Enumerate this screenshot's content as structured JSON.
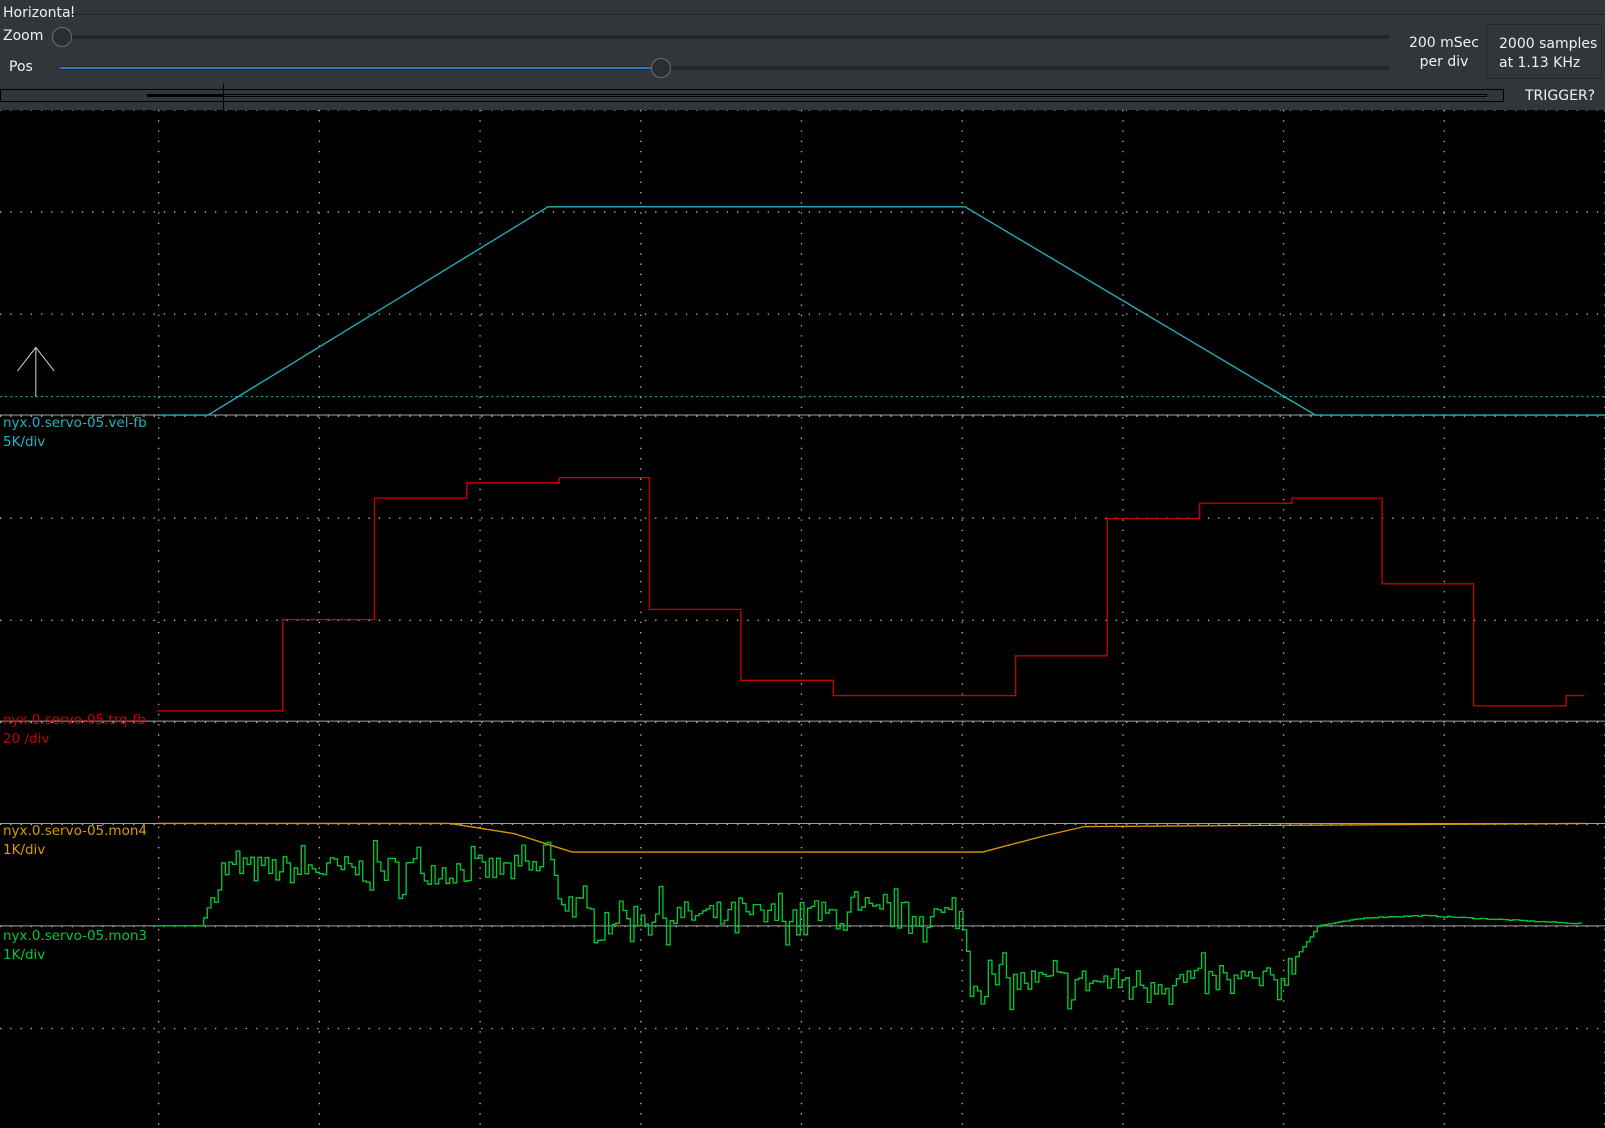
{
  "horizontal": {
    "group_label": "Horizontal",
    "zoom_label": "Zoom",
    "zoom_value": 0.0,
    "pos_label": "Pos",
    "pos_value": 0.45,
    "timebase_line1": "200 mSec",
    "timebase_line2": "per div",
    "samples_line1": "2000 samples",
    "samples_line2": "at 1.13 KHz",
    "trigger_label": "TRIGGER?"
  },
  "channels": [
    {
      "name": "nyx.0.servo-05.vel-fb",
      "scale": "5K/div",
      "color": "#1fb5c0"
    },
    {
      "name": "nyx.0.servo-05.trq-fb",
      "scale": "20 /div",
      "color": "#c80000"
    },
    {
      "name": "nyx.0.servo-05.mon4",
      "scale": "1K/div",
      "color": "#d99a00"
    },
    {
      "name": "nyx.0.servo-05.mon3",
      "scale": "1K/div",
      "color": "#00c832"
    }
  ],
  "chart_data": {
    "type": "line",
    "x_unit": "ms",
    "x_per_div": 200,
    "xlim": [
      0,
      2000
    ],
    "grid": true,
    "trigger_level": {
      "channel": 0,
      "value": 900
    },
    "series": [
      {
        "name": "nyx.0.servo-05.vel-fb",
        "units_per_div": 5000,
        "step": false,
        "points": [
          [
            195,
            0
          ],
          [
            259,
            0
          ],
          [
            682,
            10200
          ],
          [
            1201,
            10200
          ],
          [
            1637,
            0
          ],
          [
            1998,
            0
          ]
        ]
      },
      {
        "name": "nyx.0.servo-05.trq-fb",
        "units_per_div": 20,
        "step": true,
        "points": [
          [
            195,
            2.0
          ],
          [
            352,
            19.9
          ],
          [
            466,
            43.7
          ],
          [
            581,
            46.7
          ],
          [
            696,
            47.7
          ],
          [
            808,
            21.9
          ],
          [
            922,
            8.0
          ],
          [
            1037,
            5.0
          ],
          [
            1264,
            12.8
          ],
          [
            1378,
            39.7
          ],
          [
            1493,
            42.7
          ],
          [
            1608,
            43.7
          ],
          [
            1720,
            26.9
          ],
          [
            1834,
            3.0
          ],
          [
            1949,
            5.0
          ],
          [
            1972,
            5.0
          ]
        ]
      },
      {
        "name": "nyx.0.servo-05.mon4",
        "units_per_div": 1000,
        "step": false,
        "points": [
          [
            195,
            0
          ],
          [
            560,
            0
          ],
          [
            640,
            -100
          ],
          [
            712,
            -280
          ],
          [
            1223,
            -280
          ],
          [
            1300,
            -120
          ],
          [
            1350,
            -30
          ],
          [
            1974,
            0
          ]
        ]
      },
      {
        "name": "nyx.0.servo-05.mon3",
        "units_per_div": 1000,
        "step": true,
        "noise_amplitude": 180,
        "points": [
          [
            195,
            0
          ],
          [
            250,
            0
          ],
          [
            275,
            550
          ],
          [
            670,
            550
          ],
          [
            680,
            850
          ],
          [
            690,
            350
          ],
          [
            730,
            100
          ],
          [
            1195,
            100
          ],
          [
            1210,
            -550
          ],
          [
            1590,
            -550
          ],
          [
            1640,
            0
          ],
          [
            1700,
            80
          ],
          [
            1770,
            100
          ],
          [
            1970,
            20
          ]
        ]
      }
    ]
  }
}
